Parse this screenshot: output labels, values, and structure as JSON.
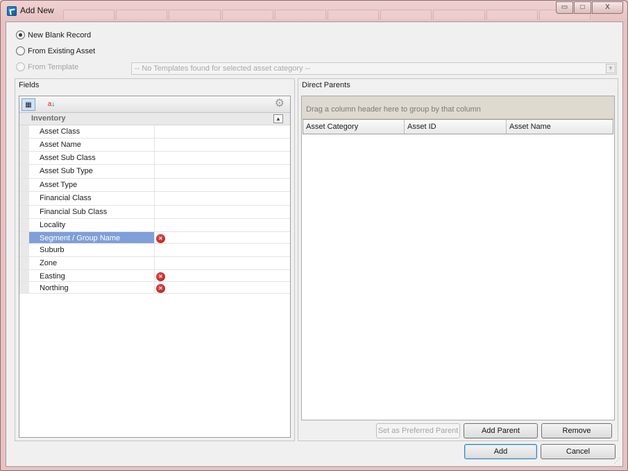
{
  "window": {
    "title": "Add New",
    "buttons": {
      "minimize": "▭",
      "maximize": "□",
      "close": "X"
    }
  },
  "options": {
    "new_blank": "New Blank Record",
    "from_existing": "From Existing Asset",
    "from_template": "From Template",
    "template_placeholder": "-- No Templates found for selected asset category --"
  },
  "fields": {
    "title": "Fields",
    "category": "Inventory",
    "rows": [
      {
        "name": "Asset Class",
        "error": false,
        "selected": false
      },
      {
        "name": "Asset Name",
        "error": false,
        "selected": false
      },
      {
        "name": "Asset Sub Class",
        "error": false,
        "selected": false
      },
      {
        "name": "Asset Sub Type",
        "error": false,
        "selected": false
      },
      {
        "name": "Asset Type",
        "error": false,
        "selected": false
      },
      {
        "name": "Financial Class",
        "error": false,
        "selected": false
      },
      {
        "name": "Financial Sub Class",
        "error": false,
        "selected": false
      },
      {
        "name": "Locality",
        "error": false,
        "selected": false
      },
      {
        "name": "Segment / Group Name",
        "error": true,
        "selected": true
      },
      {
        "name": "Suburb",
        "error": false,
        "selected": false
      },
      {
        "name": "Zone",
        "error": false,
        "selected": false
      },
      {
        "name": "Easting",
        "error": true,
        "selected": false
      },
      {
        "name": "Northing",
        "error": true,
        "selected": false
      }
    ],
    "icons": {
      "categorized": "categorized-view-icon",
      "alphabetical": "sort-alphabetical-icon",
      "settings": "gear-icon",
      "error": "error-icon"
    }
  },
  "parents": {
    "title": "Direct Parents",
    "group_hint": "Drag a column header here to group by that column",
    "columns": [
      "Asset Category",
      "Asset ID",
      "Asset Name"
    ],
    "set_preferred": "Set as Preferred Parent",
    "add_parent": "Add Parent",
    "remove": "Remove"
  },
  "footer": {
    "add": "Add",
    "cancel": "Cancel"
  }
}
